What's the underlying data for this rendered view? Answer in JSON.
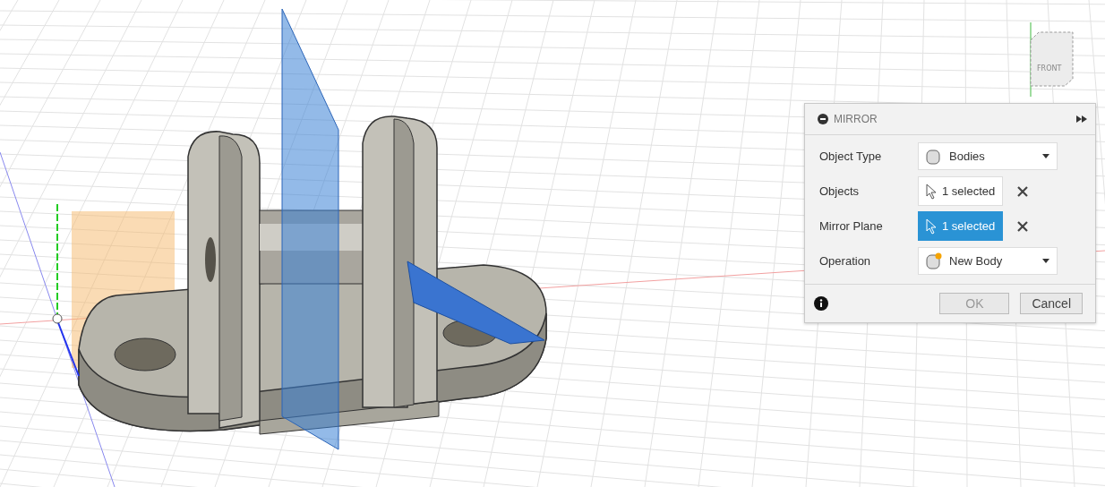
{
  "viewcube": {
    "label": "FRONT"
  },
  "dialog": {
    "title": "MIRROR",
    "rows": [
      {
        "label": "Object Type",
        "kind": "type",
        "value": "Bodies"
      },
      {
        "label": "Objects",
        "kind": "selection",
        "value": "1 selected",
        "selected": false
      },
      {
        "label": "Mirror Plane",
        "kind": "selection",
        "value": "1 selected",
        "selected": true
      },
      {
        "label": "Operation",
        "kind": "operation",
        "value": "New Body"
      }
    ],
    "buttons": [
      {
        "label": "OK",
        "disabled": true
      },
      {
        "label": "Cancel",
        "disabled": false
      }
    ]
  }
}
